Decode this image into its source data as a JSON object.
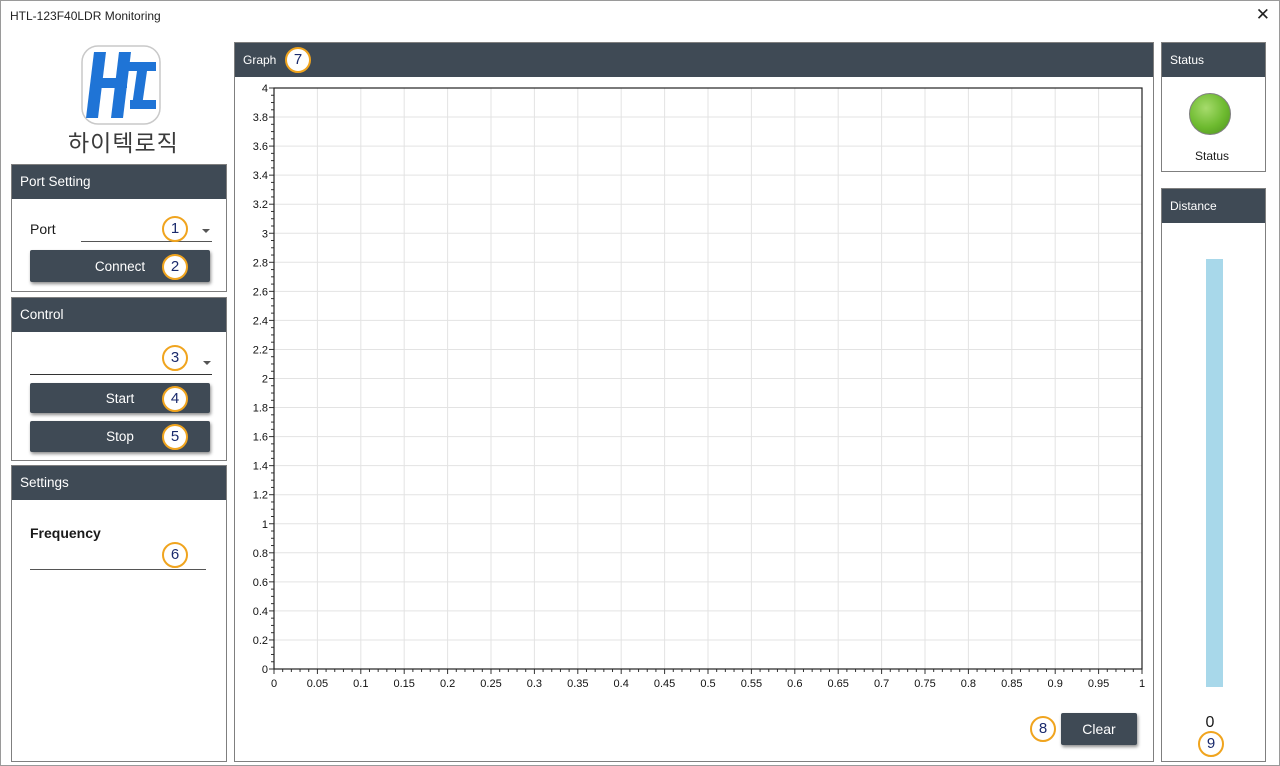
{
  "window": {
    "title": "HTL-123F40LDR Monitoring",
    "close_glyph": "✕"
  },
  "logo": {
    "text": "하이텍로직",
    "icon": "htl-logo-icon"
  },
  "port_setting": {
    "header": "Port Setting",
    "port_label": "Port",
    "port_value": "",
    "connect_label": "Connect"
  },
  "control": {
    "header": "Control",
    "mode_value": "",
    "start_label": "Start",
    "stop_label": "Stop"
  },
  "settings": {
    "header": "Settings",
    "frequency_label": "Frequency",
    "frequency_value": ""
  },
  "graph": {
    "header": "Graph",
    "clear_label": "Clear"
  },
  "status": {
    "header": "Status",
    "label": "Status",
    "led_color": "#6dba2f"
  },
  "distance": {
    "header": "Distance",
    "value": "0",
    "bar_color": "#a8d8ea",
    "level": 0
  },
  "badges": [
    "1",
    "2",
    "3",
    "4",
    "5",
    "6",
    "7",
    "8",
    "9"
  ],
  "colors": {
    "header_bg": "#3f4a55",
    "badge_border": "#f0a41e",
    "badge_text": "#1a2a6c"
  },
  "chart_data": {
    "type": "line",
    "title": "",
    "xlabel": "",
    "ylabel": "",
    "xlim": [
      0,
      1
    ],
    "ylim": [
      0,
      4
    ],
    "x_ticks": [
      "0",
      "0.05",
      "0.1",
      "0.15",
      "0.2",
      "0.25",
      "0.3",
      "0.35",
      "0.4",
      "0.45",
      "0.5",
      "0.55",
      "0.6",
      "0.65",
      "0.7",
      "0.75",
      "0.8",
      "0.85",
      "0.9",
      "0.95",
      "1"
    ],
    "y_ticks": [
      "0",
      "0.2",
      "0.4",
      "0.6",
      "0.8",
      "1",
      "1.2",
      "1.4",
      "1.6",
      "1.8",
      "2",
      "2.2",
      "2.4",
      "2.6",
      "2.8",
      "3",
      "3.2",
      "3.4",
      "3.6",
      "3.8",
      "4"
    ],
    "grid": true,
    "series": []
  }
}
